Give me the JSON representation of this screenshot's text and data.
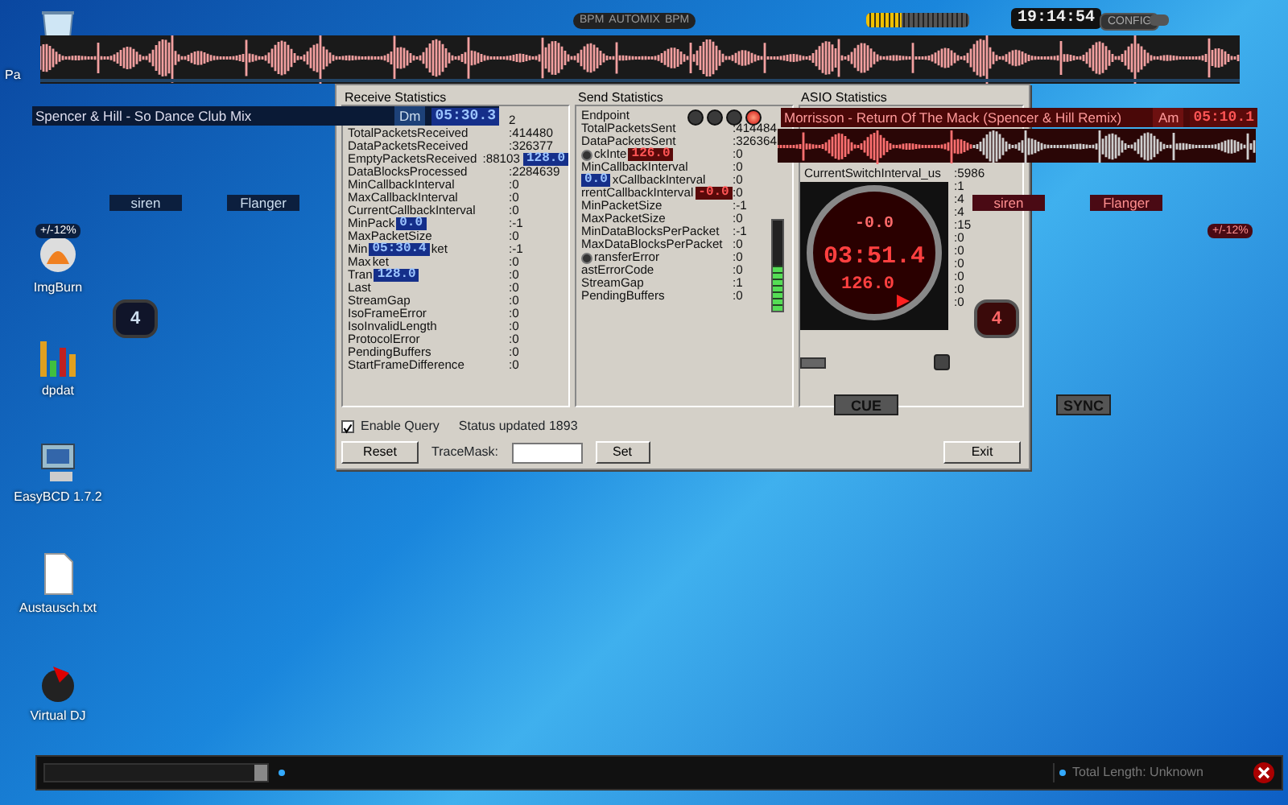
{
  "desktop_icons": [
    {
      "kind": "recycle",
      "label": "Pa"
    },
    {
      "kind": "disc",
      "label": "ImgBurn"
    },
    {
      "kind": "chart",
      "label": "dpdat"
    },
    {
      "kind": "computer",
      "label": "EasyBCD 1.7.2"
    },
    {
      "kind": "file",
      "label": "Austausch.txt"
    },
    {
      "kind": "record",
      "label": "Virtual DJ"
    }
  ],
  "top_bar": {
    "buttons": [
      "BPM",
      "AUTOMIX",
      "BPM"
    ],
    "level": 0.35,
    "clock": "19:14:54",
    "config": "CONFIG"
  },
  "decks": [
    {
      "title": "Spencer & Hill - So Dance  Club Mix",
      "key": "Dm",
      "time": "05:30.3",
      "effects": [
        "siren",
        "Flanger"
      ],
      "pitch_range": "+/-12%",
      "loop": "4"
    },
    {
      "title": "Morrisson - Return Of The Mack (Spencer & Hill Remix)",
      "key": "Am",
      "time": "05:10.1",
      "effects": [
        "siren",
        "Flanger"
      ],
      "pitch_range": "+/-12%",
      "loop": "4",
      "jog": {
        "pitch": "-0.0",
        "time": "03:51.4",
        "bpm": "126.0"
      },
      "cue": "CUE",
      "sync": "SYNC"
    }
  ],
  "dialog": {
    "receive": {
      "title": "Receive Statistics",
      "rows": [
        {
          "label": [],
          "value": [
            {
              "kind": "text",
              "text": "2"
            }
          ]
        },
        {
          "label": [
            {
              "kind": "text",
              "text": "TotalPacketsReceived"
            }
          ],
          "value": [
            {
              "kind": "text",
              "text": ":414480"
            }
          ]
        },
        {
          "label": [
            {
              "kind": "text",
              "text": "DataPacketsReceived"
            }
          ],
          "value": [
            {
              "kind": "text",
              "text": ":326377"
            }
          ]
        },
        {
          "label": [
            {
              "kind": "text",
              "text": "EmptyPacketsReceived"
            }
          ],
          "value": [
            {
              "kind": "text",
              "text": ":88103"
            },
            {
              "kind": "blue_display",
              "text": "128.0"
            }
          ]
        },
        {
          "label": [
            {
              "kind": "text",
              "text": "DataBlocksProcessed"
            }
          ],
          "value": [
            {
              "kind": "text",
              "text": ":2284639"
            }
          ]
        },
        {
          "label": [
            {
              "kind": "text",
              "text": "MinCallbackInterval"
            }
          ],
          "value": [
            {
              "kind": "text",
              "text": ":0"
            }
          ]
        },
        {
          "label": [
            {
              "kind": "text",
              "text": "MaxCallbackInterval"
            }
          ],
          "value": [
            {
              "kind": "text",
              "text": ":0"
            }
          ]
        },
        {
          "label": [
            {
              "kind": "text",
              "text": "CurrentCallbackInterval"
            }
          ],
          "value": [
            {
              "kind": "text",
              "text": ":0"
            }
          ]
        },
        {
          "label": [
            {
              "kind": "text",
              "text": "MinPack"
            },
            {
              "kind": "blue_display",
              "text": "0.0"
            }
          ],
          "value": [
            {
              "kind": "text",
              "text": ":-1"
            }
          ]
        },
        {
          "label": [
            {
              "kind": "text",
              "text": "MaxPacketSize"
            }
          ],
          "value": [
            {
              "kind": "text",
              "text": ":0"
            }
          ]
        },
        {
          "label": [
            {
              "kind": "text",
              "text": "Min"
            },
            {
              "kind": "blue_display",
              "text": "05:30.4"
            },
            {
              "kind": "text",
              "text": "ket"
            }
          ],
          "value": [
            {
              "kind": "text",
              "text": ":-1"
            }
          ]
        },
        {
          "label": [
            {
              "kind": "text",
              "text": "Max"
            },
            {
              "kind": "text",
              "text": "ket"
            }
          ],
          "value": [
            {
              "kind": "text",
              "text": ":0"
            }
          ]
        },
        {
          "label": [
            {
              "kind": "text",
              "text": "Tran"
            },
            {
              "kind": "blue_display",
              "text": "128.0"
            }
          ],
          "value": [
            {
              "kind": "text",
              "text": ":0"
            }
          ]
        },
        {
          "label": [
            {
              "kind": "text",
              "text": "Last"
            }
          ],
          "value": [
            {
              "kind": "text",
              "text": ":0"
            }
          ]
        },
        {
          "label": [
            {
              "kind": "text",
              "text": "StreamGap"
            }
          ],
          "value": [
            {
              "kind": "text",
              "text": ":0"
            }
          ]
        },
        {
          "label": [
            {
              "kind": "text",
              "text": "IsoFrameError"
            }
          ],
          "value": [
            {
              "kind": "text",
              "text": ":0"
            }
          ]
        },
        {
          "label": [
            {
              "kind": "text",
              "text": "IsoInvalidLength"
            }
          ],
          "value": [
            {
              "kind": "text",
              "text": ":0"
            }
          ]
        },
        {
          "label": [
            {
              "kind": "text",
              "text": "ProtocolError"
            }
          ],
          "value": [
            {
              "kind": "text",
              "text": ":0"
            }
          ]
        },
        {
          "label": [
            {
              "kind": "text",
              "text": "PendingBuffers"
            }
          ],
          "value": [
            {
              "kind": "text",
              "text": ":0"
            }
          ]
        },
        {
          "label": [
            {
              "kind": "text",
              "text": "StartFrameDifference"
            }
          ],
          "value": [
            {
              "kind": "text",
              "text": ":0"
            }
          ]
        }
      ]
    },
    "send": {
      "title": "Send Statistics",
      "lights": [
        {
          "on": false
        },
        {
          "on": false
        },
        {
          "on": false
        },
        {
          "on": true
        }
      ],
      "meter": {
        "level": 0.5
      },
      "rows": [
        {
          "label": [
            {
              "kind": "text",
              "text": "Endpoint"
            }
          ],
          "value": []
        },
        {
          "label": [
            {
              "kind": "text",
              "text": "TotalPacketsSent"
            }
          ],
          "value": [
            {
              "kind": "text",
              "text": ":414484"
            }
          ]
        },
        {
          "label": [
            {
              "kind": "text",
              "text": "DataPacketsSent"
            }
          ],
          "value": [
            {
              "kind": "text",
              "text": ":326364"
            }
          ]
        },
        {
          "label": [
            {
              "kind": "knob"
            },
            {
              "kind": "text",
              "text": "ckInte"
            },
            {
              "kind": "red_display",
              "text": "126.0"
            }
          ],
          "value": [
            {
              "kind": "text",
              "text": ":0"
            }
          ]
        },
        {
          "label": [
            {
              "kind": "text",
              "text": "MinCallbackInterval"
            }
          ],
          "value": [
            {
              "kind": "text",
              "text": ":0"
            }
          ]
        },
        {
          "label": [
            {
              "kind": "blue_display",
              "text": "0.0"
            },
            {
              "kind": "text",
              "text": "xCallbackInterval"
            }
          ],
          "value": [
            {
              "kind": "text",
              "text": ":0"
            }
          ]
        },
        {
          "label": [
            {
              "kind": "text",
              "text": "rrentCallbackInterval"
            },
            {
              "kind": "red_display",
              "text": "-0.0"
            }
          ],
          "value": [
            {
              "kind": "text",
              "text": ":0"
            }
          ]
        },
        {
          "label": [
            {
              "kind": "text",
              "text": "MinPacketSize"
            }
          ],
          "value": [
            {
              "kind": "text",
              "text": ":-1"
            }
          ]
        },
        {
          "label": [
            {
              "kind": "text",
              "text": "MaxPacketSize"
            }
          ],
          "value": [
            {
              "kind": "text",
              "text": ":0"
            }
          ]
        },
        {
          "label": [
            {
              "kind": "text",
              "text": "MinDataBlocksPerPacket"
            }
          ],
          "value": [
            {
              "kind": "text",
              "text": ":-1"
            }
          ]
        },
        {
          "label": [
            {
              "kind": "text",
              "text": "MaxDataBlocksPerPacket"
            }
          ],
          "value": [
            {
              "kind": "text",
              "text": ":0"
            }
          ]
        },
        {
          "label": [
            {
              "kind": "knob"
            },
            {
              "kind": "text",
              "text": "ransferError"
            }
          ],
          "value": [
            {
              "kind": "text",
              "text": ":0"
            }
          ]
        },
        {
          "label": [
            {
              "kind": "text",
              "text": "astErrorCode"
            }
          ],
          "value": [
            {
              "kind": "text",
              "text": ":0"
            }
          ]
        },
        {
          "label": [
            {
              "kind": "text",
              "text": "StreamGap"
            }
          ],
          "value": [
            {
              "kind": "text",
              "text": ":1"
            }
          ]
        },
        {
          "label": [
            {
              "kind": "text",
              "text": "PendingBuffers"
            }
          ],
          "value": [
            {
              "kind": "text",
              "text": ":0"
            }
          ]
        }
      ]
    },
    "asio": {
      "title": "ASIO Statistics",
      "rows": [
        {
          "label": [
            {
              "kind": "text",
              "text": "CurrentSwitchInterval_us"
            }
          ],
          "value": [
            {
              "kind": "text",
              "text": ":5986"
            }
          ]
        },
        {
          "label": [],
          "value": [
            {
              "kind": "text",
              "text": ":1"
            }
          ]
        },
        {
          "label": [],
          "value": [
            {
              "kind": "text",
              "text": ":4"
            }
          ]
        },
        {
          "label": [],
          "value": [
            {
              "kind": "text",
              "text": ":4"
            }
          ]
        },
        {
          "label": [],
          "value": [
            {
              "kind": "text",
              "text": ":15"
            }
          ]
        },
        {
          "label": [],
          "value": [
            {
              "kind": "text",
              "text": ":0"
            }
          ]
        },
        {
          "label": [],
          "value": [
            {
              "kind": "text",
              "text": ":0"
            }
          ]
        },
        {
          "label": [],
          "value": [
            {
              "kind": "text",
              "text": ":0"
            }
          ]
        },
        {
          "label": [],
          "value": [
            {
              "kind": "text",
              "text": ":0"
            }
          ]
        },
        {
          "label": [],
          "value": [
            {
              "kind": "text",
              "text": ":0"
            }
          ]
        },
        {
          "label": [],
          "value": [
            {
              "kind": "text",
              "text": ":0"
            }
          ]
        }
      ]
    },
    "enable_query": {
      "label": "Enable Query",
      "checked": true
    },
    "status": "Status updated 1893",
    "reset": "Reset",
    "trace_mask_label": "TraceMask:",
    "set": "Set",
    "exit": "Exit"
  },
  "bottom_bar": {
    "total_length": "Total Length: Unknown"
  }
}
